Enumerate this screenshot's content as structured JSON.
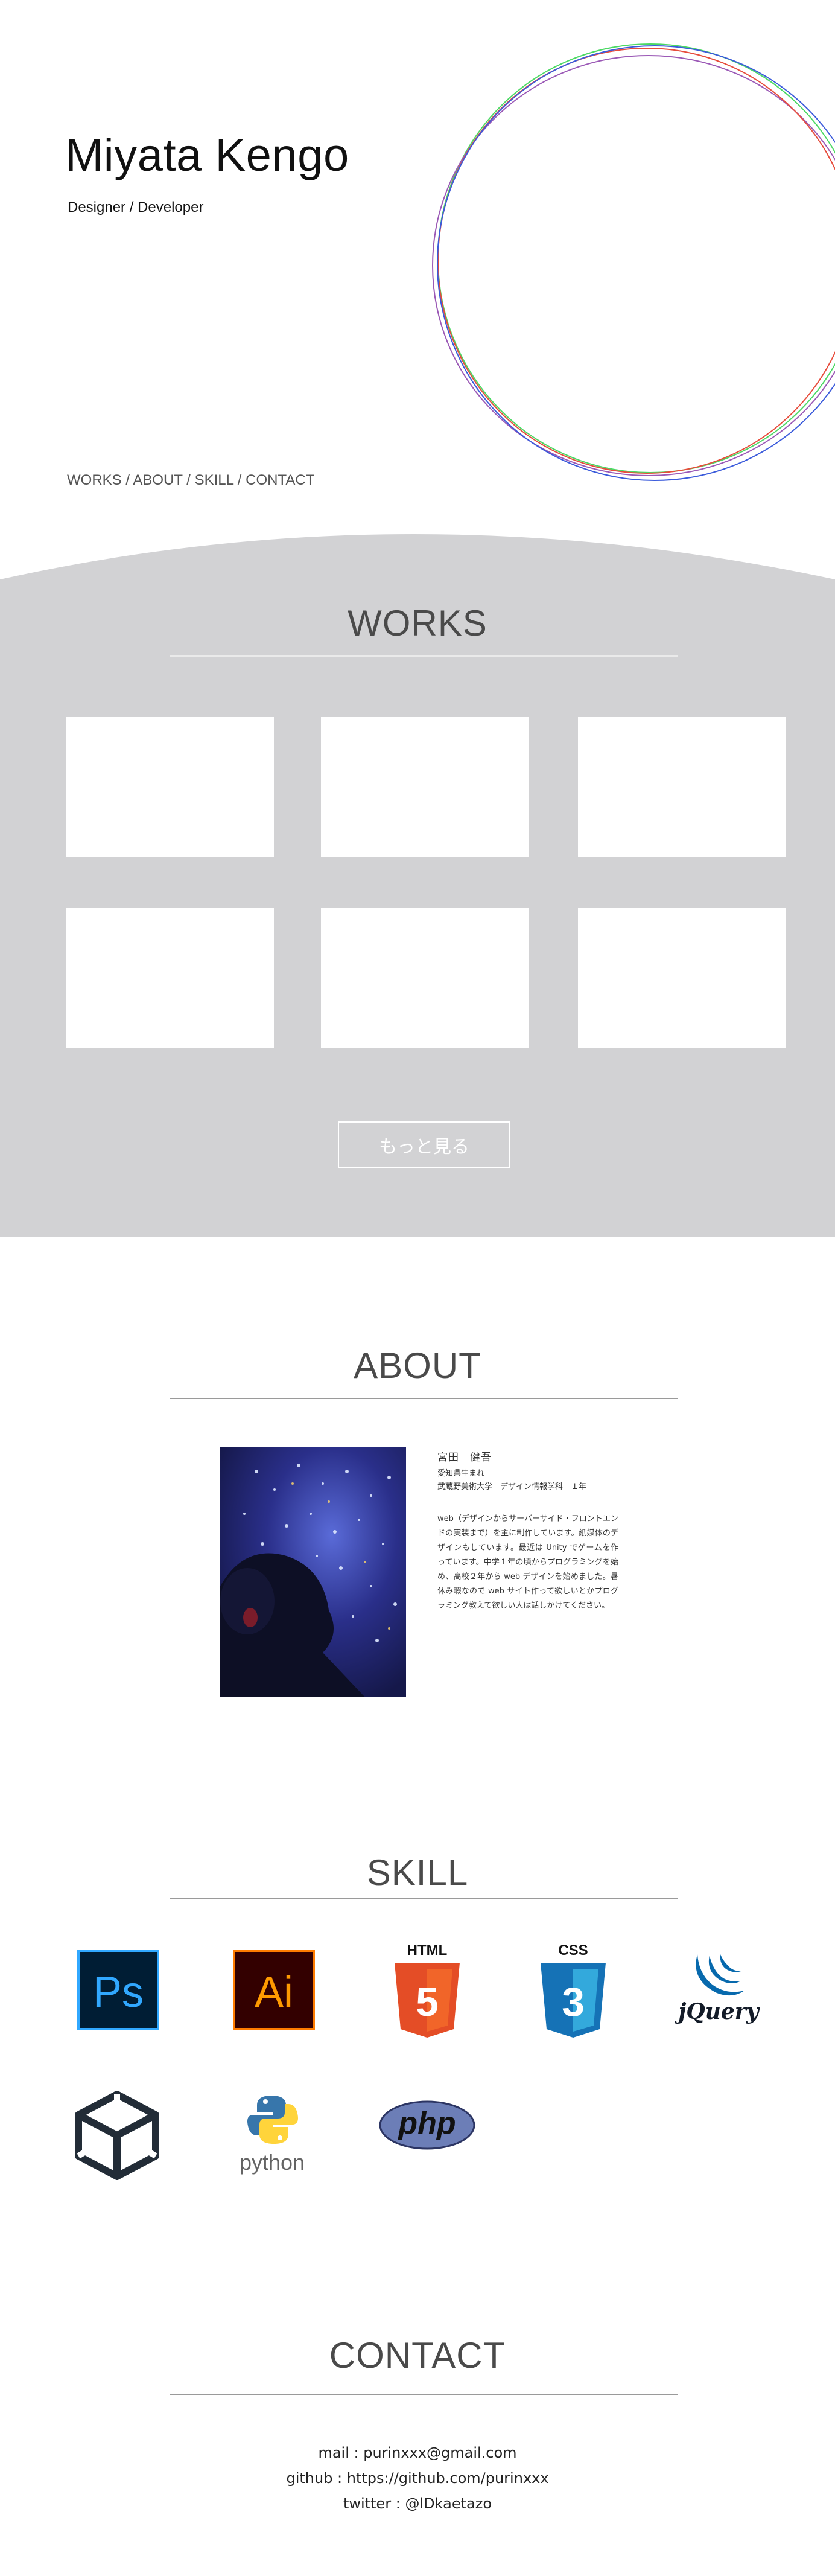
{
  "hero": {
    "title": "Miyata Kengo",
    "subtitle": "Designer / Developer",
    "circle_colors": [
      "#4cd964",
      "#9b59b6",
      "#e74c3c",
      "#3b5bdb"
    ]
  },
  "nav": {
    "items": [
      "WORKS",
      "ABOUT",
      "SKILL",
      "CONTACT"
    ],
    "separator": " / "
  },
  "works": {
    "title": "WORKS",
    "background": "#d2d2d4",
    "card_count": 6,
    "more_label": "もっと見る"
  },
  "about": {
    "title": "ABOUT",
    "name": "宮田　健吾",
    "birthplace": "愛知県生まれ",
    "school": "武蔵野美術大学　デザイン情報学科　１年",
    "bio": "web（デザインからサーバーサイド・フロントエンドの実装まで）を主に制作しています。紙媒体のデザインもしています。最近は Unity でゲームを作っています。中学１年の頃からプログラミングを始め、高校２年から web デザインを始めました。暑休み暇なので web サイト作って欲しいとかプログラミング教えて欲しい人は話しかけてください。"
  },
  "skill": {
    "title": "SKILL",
    "icons": [
      {
        "name": "photoshop-icon",
        "label": "Ps"
      },
      {
        "name": "illustrator-icon",
        "label": "Ai"
      },
      {
        "name": "html5-icon",
        "label": "HTML",
        "badge": "5"
      },
      {
        "name": "css3-icon",
        "label": "CSS",
        "badge": "3"
      },
      {
        "name": "jquery-icon",
        "label": "jQuery"
      },
      {
        "name": "unity-icon",
        "label": ""
      },
      {
        "name": "python-icon",
        "label": "python"
      },
      {
        "name": "php-icon",
        "label": "php"
      }
    ]
  },
  "contact": {
    "title": "CONTACT",
    "mail": "mail : purinxxx@gmail.com",
    "github": "github : https://github.com/purinxxx",
    "twitter": "twitter :  @lDkaetazo"
  }
}
